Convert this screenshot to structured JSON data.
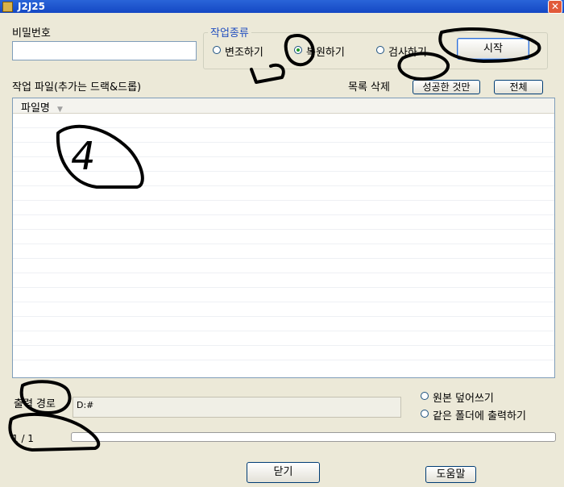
{
  "window": {
    "title": "J2J25",
    "close_glyph": "✕"
  },
  "password": {
    "label": "비밀번호",
    "value": ""
  },
  "job_type": {
    "title": "작업종류",
    "options": [
      {
        "label": "변조하기",
        "checked": false
      },
      {
        "label": "복원하기",
        "checked": true
      },
      {
        "label": "검사하기",
        "checked": false
      }
    ],
    "start_label": "시작"
  },
  "file_list": {
    "label": "작업 파일(추가는 드랙&드롭)",
    "delete_label": "목록 삭제",
    "delete_success_label": "성공한 것만",
    "delete_all_label": "전체",
    "column_filename": "파일명",
    "sort_glyph": "▼",
    "rows": []
  },
  "output": {
    "label": "출력 경로",
    "path": "D:#",
    "options": [
      {
        "label": "원본 덮어쓰기",
        "checked": false
      },
      {
        "label": "같은 폴더에 출력하기",
        "checked": false
      }
    ]
  },
  "progress": {
    "text": "1 / 1",
    "fraction": 0
  },
  "footer": {
    "close_label": "닫기",
    "help_label": "도움말"
  },
  "annotations": {
    "note_number": "4"
  },
  "colors": {
    "titlebar": "#1448c4",
    "group_title": "#1f4dbf",
    "checked_radio": "#1e9b2a"
  }
}
